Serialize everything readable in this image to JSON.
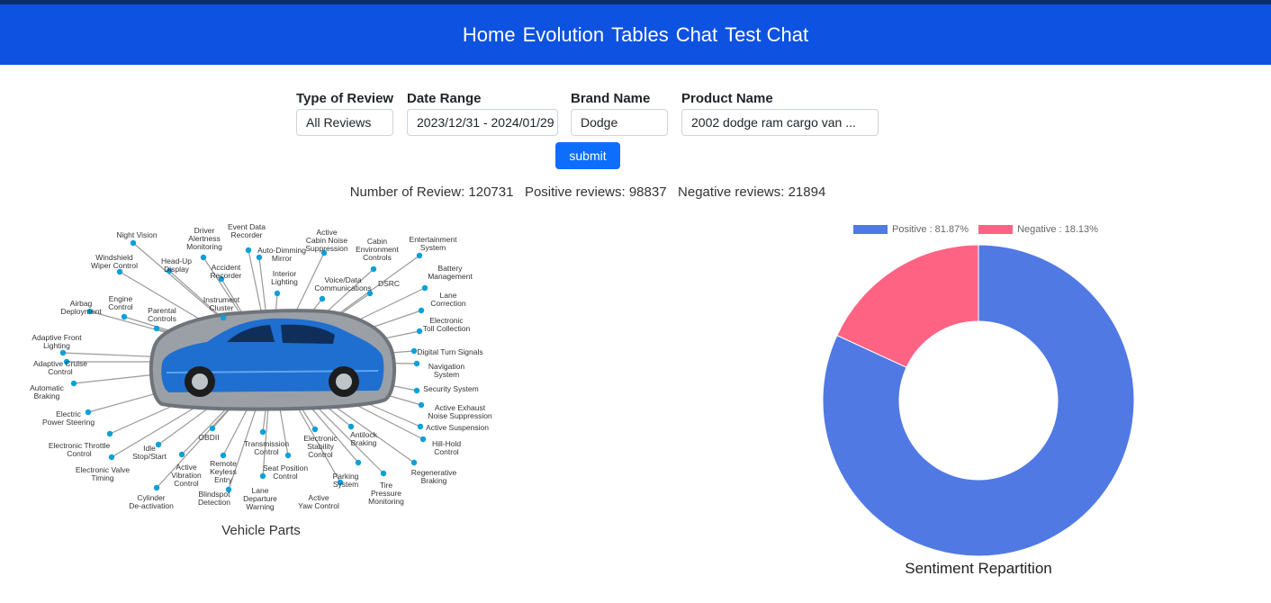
{
  "nav": {
    "links": [
      "Home",
      "Evolution",
      "Tables",
      "Chat",
      "Test Chat"
    ]
  },
  "filters": {
    "review_type": {
      "label": "Type of Review",
      "value": "All Reviews"
    },
    "date_range": {
      "label": "Date Range",
      "value": "2023/12/31 - 2024/01/29"
    },
    "brand": {
      "label": "Brand Name",
      "value": "Dodge"
    },
    "product": {
      "label": "Product Name",
      "value": "2002 dodge ram cargo van ..."
    },
    "submit_label": "submit"
  },
  "stats": {
    "text": "Number of Review: 120731   Positive reviews: 98837   Negative reviews: 21894"
  },
  "vehicle_parts": {
    "caption": "Vehicle Parts",
    "labels": [
      "Night Vision",
      "Driver\nAlertness\nMonitoring",
      "Event Data\nRecorder",
      "Active\nCabin Noise\nSuppression",
      "Cabin\nEnvironment\nControls",
      "Entertainment\nSystem",
      "Windshield\nWiper Control",
      "Head-Up\nDisplay",
      "Accident\nRecorder",
      "Auto-Dimming\nMirror",
      "Interior\nLighting",
      "Voice/Data\nCommunications",
      "DSRC",
      "Battery\nManagement",
      "Airbag\nDeployment",
      "Engine\nControl",
      "Parental\nControls",
      "Instrument\nCluster",
      "Lane\nCorrection",
      "Electronic\nToll Collection",
      "Adaptive Front\nLighting",
      "Digital Turn Signals",
      "Adaptive Cruise\nControl",
      "Navigation\nSystem",
      "Automatic\nBraking",
      "Security System",
      "Active Exhaust\nNoise Suppression",
      "Electric\nPower Steering",
      "Active Suspension",
      "Electronic Throttle\nControl",
      "Idle\nStop/Start",
      "OBDII",
      "Transmission\nControl",
      "Electronic\nStability\nControl",
      "Antilock\nBraking",
      "Hill-Hold\nControl",
      "Electronic Valve\nTiming",
      "Active\nVibration\nControl",
      "Remote\nKeyless\nEntry",
      "Seat Position\nControl",
      "Regenerative\nBraking",
      "Cylinder\nDe-activation",
      "Blindspot\nDetection",
      "Lane\nDeparture\nWarning",
      "Parking\nSystem",
      "Tire\nPressure\nMonitoring",
      "Active\nYaw Control"
    ]
  },
  "chart_data": {
    "type": "pie",
    "subtype": "doughnut",
    "title": "Sentiment Repartition",
    "legend_position": "top",
    "series": [
      {
        "name": "Positive : 81.87%",
        "value": 81.87,
        "color": "#5079e4"
      },
      {
        "name": "Negative : 18.13%",
        "value": 18.13,
        "color": "#ff6384"
      }
    ]
  },
  "colors": {
    "navbar": "#0d52e0",
    "button": "#0d6efd",
    "dot": "#0aa0d8"
  }
}
